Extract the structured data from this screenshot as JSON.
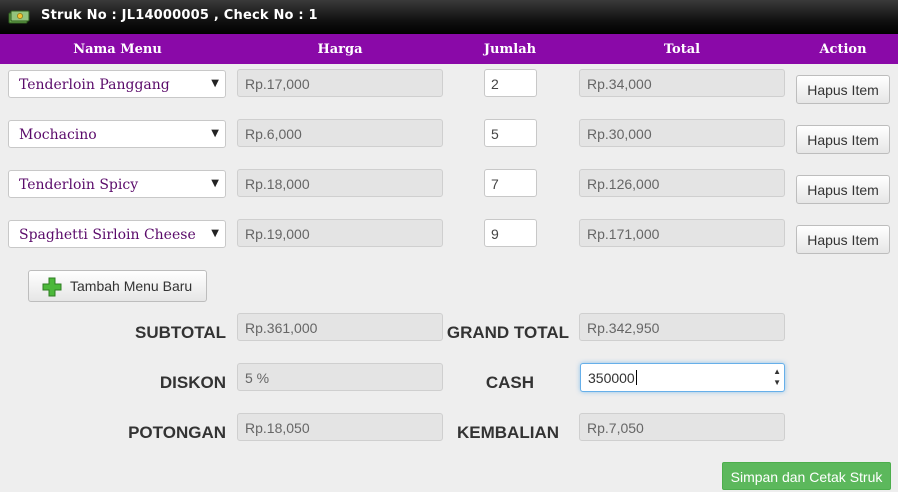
{
  "header": {
    "title": "Struk No : JL14000005 , Check No : 1",
    "icon": "money-icon"
  },
  "columns": [
    "Nama Menu",
    "Harga",
    "Jumlah",
    "Total",
    "Action"
  ],
  "items": [
    {
      "menu": "Tenderloin Panggang",
      "harga": "Rp.17,000",
      "jumlah": "2",
      "total": "Rp.34,000",
      "action": "Hapus Item"
    },
    {
      "menu": "Mochacino",
      "harga": "Rp.6,000",
      "jumlah": "5",
      "total": "Rp.30,000",
      "action": "Hapus Item"
    },
    {
      "menu": "Tenderloin Spicy",
      "harga": "Rp.18,000",
      "jumlah": "7",
      "total": "Rp.126,000",
      "action": "Hapus Item"
    },
    {
      "menu": "Spaghetti Sirloin Cheese",
      "harga": "Rp.19,000",
      "jumlah": "9",
      "total": "Rp.171,000",
      "action": "Hapus Item"
    }
  ],
  "add_button": {
    "label": "Tambah Menu Baru",
    "icon": "plus-icon"
  },
  "summary": {
    "subtotal_label": "SUBTOTAL",
    "subtotal": "Rp.361,000",
    "diskon_label": "DISKON",
    "diskon": "5 %",
    "potongan_label": "POTONGAN",
    "potongan": "Rp.18,050",
    "grand_total_label": "GRAND TOTAL",
    "grand_total": "Rp.342,950",
    "cash_label": "CASH",
    "cash": "350000",
    "kembalian_label": "KEMBALIAN",
    "kembalian": "Rp.7,050"
  },
  "save_button": {
    "label": "Simpan dan Cetak Struk"
  },
  "colors": {
    "header_bar": "#8a09a8",
    "title_bar": "#000000",
    "save": "#5cb85c"
  }
}
